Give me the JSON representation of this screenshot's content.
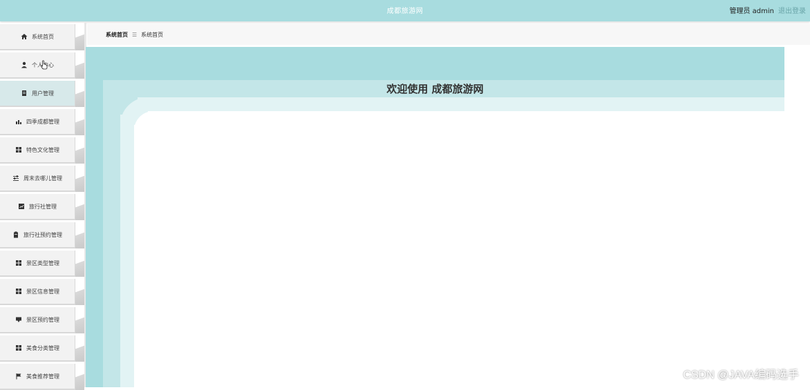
{
  "header": {
    "title": "成都旅游网",
    "user_label": "管理员 admin",
    "logout_label": "退出登录"
  },
  "breadcrumb": {
    "home": "系统首页",
    "separator": "☰",
    "current": "系统首页"
  },
  "welcome": {
    "text": "欢迎使用 成都旅游网"
  },
  "sidebar": {
    "items": [
      {
        "label": "系统首页",
        "icon": "home-icon"
      },
      {
        "label": "个人中心",
        "icon": "user-icon"
      },
      {
        "label": "用户管理",
        "icon": "document-icon"
      },
      {
        "label": "四季成都管理",
        "icon": "chart-icon"
      },
      {
        "label": "特色文化管理",
        "icon": "grid-icon"
      },
      {
        "label": "周末去哪儿管理",
        "icon": "sliders-icon"
      },
      {
        "label": "旅行社管理",
        "icon": "report-icon"
      },
      {
        "label": "旅行社预约管理",
        "icon": "clipboard-icon"
      },
      {
        "label": "景区类型管理",
        "icon": "grid-icon"
      },
      {
        "label": "景区信息管理",
        "icon": "grid-icon"
      },
      {
        "label": "景区预约管理",
        "icon": "comment-icon"
      },
      {
        "label": "美食分类管理",
        "icon": "grid-icon"
      },
      {
        "label": "美食推荐管理",
        "icon": "flag-icon"
      }
    ],
    "active_index": 2
  },
  "watermark": "CSDN @JAVA编码选手",
  "colors": {
    "accent": "#a8dcdf",
    "accent_light": "#c3e6e8",
    "accent_lighter": "#e2f3f4"
  }
}
